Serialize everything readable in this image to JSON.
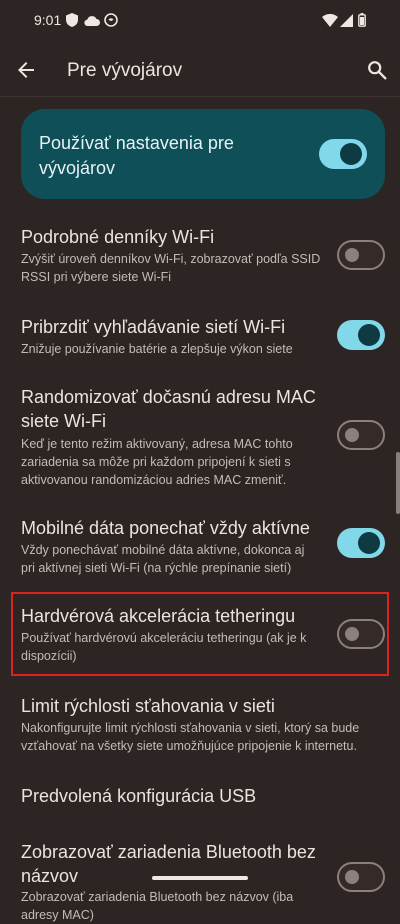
{
  "status_bar": {
    "time": "9:01",
    "left_icons": [
      "shield-icon",
      "cloud-icon",
      "messenger-icon"
    ],
    "right_icons": [
      "wifi-icon",
      "signal-icon",
      "battery-icon"
    ]
  },
  "app_bar": {
    "title": "Pre vývojárov"
  },
  "master_switch": {
    "label": "Používať nastavenia pre vývojárov",
    "state": "on"
  },
  "settings": [
    {
      "title": "Podrobné denníky Wi-Fi",
      "subtitle": "Zvýšiť úroveň denníkov Wi-Fi, zobrazovať podľa SSID RSSI pri výbere siete Wi-Fi",
      "toggle": "off"
    },
    {
      "title": "Pribrzdiť vyhľadávanie sietí Wi-Fi",
      "subtitle": "Znižuje používanie batérie a zlepšuje výkon siete",
      "toggle": "on"
    },
    {
      "title": "Randomizovať dočasnú adresu MAC siete Wi-Fi",
      "subtitle": "Keď je tento režim aktivovaný, adresa MAC tohto zariadenia sa môže pri každom pripojení k sieti s aktivovanou randomizáciou adries MAC zmeniť.",
      "toggle": "off"
    },
    {
      "title": "Mobilné dáta ponechať vždy aktívne",
      "subtitle": "Vždy ponechávať mobilné dáta aktívne, dokonca aj pri aktívnej sieti Wi-Fi (na rýchle prepínanie sietí)",
      "toggle": "on"
    },
    {
      "title": "Hardvérová akcelerácia tetheringu",
      "subtitle": "Používať hardvérovú akceleráciu tetheringu (ak je k dispozícii)",
      "toggle": "off"
    },
    {
      "title": "Limit rýchlosti sťahovania v sieti",
      "subtitle": "Nakonfigurujte limit rýchlosti sťahovania v sieti, ktorý sa bude vzťahovať na všetky siete umožňujúce pripojenie k internetu."
    },
    {
      "title": "Predvolená konfigurácia USB"
    },
    {
      "title": "Zobrazovať zariadenia Bluetooth bez názvov",
      "subtitle": "Zobrazovať zariadenia Bluetooth bez názvov (iba adresy MAC)",
      "toggle": "off"
    }
  ],
  "colors": {
    "background": "#2d2523",
    "accent_on": "#80d8ea",
    "master_card": "#0f4f58",
    "highlight_border": "#d9251e"
  }
}
